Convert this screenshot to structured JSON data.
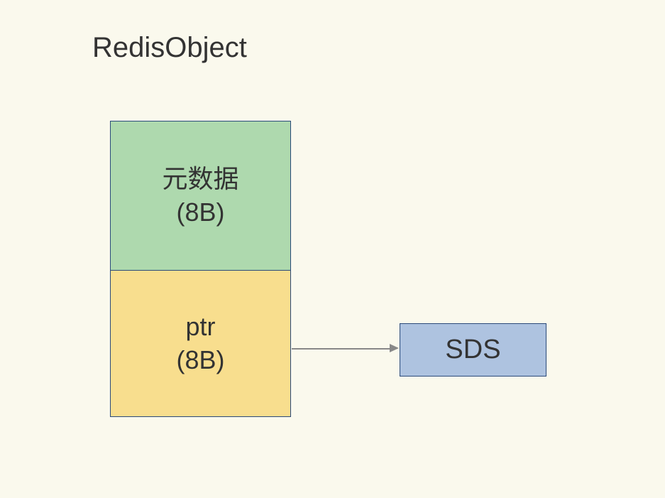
{
  "diagram": {
    "title": "RedisObject",
    "metadata": {
      "line1": "元数据",
      "line2": "(8B)"
    },
    "ptr": {
      "line1": "ptr",
      "line2": "(8B)"
    },
    "sds": {
      "label": "SDS"
    }
  }
}
